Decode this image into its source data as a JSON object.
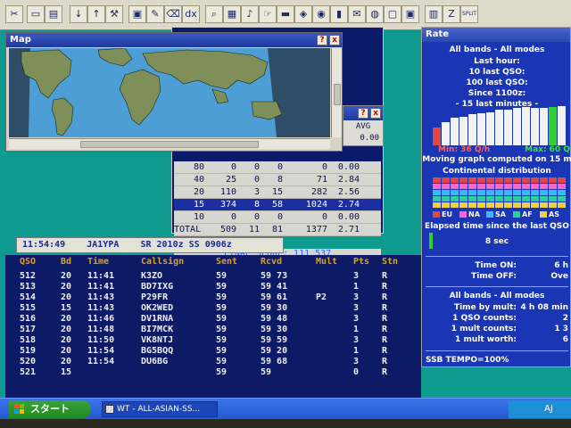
{
  "toolbar": {
    "icons": [
      "cut-icon",
      "open-folder-icon",
      "open-icon",
      "down-arrow-icon",
      "up-arrow-icon",
      "tools-icon",
      "print-icon",
      "edit-icon",
      "clear-icon",
      "dx-icon",
      "zoom-icon",
      "grid-icon",
      "bell-icon",
      "hand-icon",
      "monitor-icon",
      "tag-icon",
      "radio-icon",
      "chart-icon",
      "message-icon",
      "globe-icon",
      "window-icon",
      "window2-icon",
      "book-icon",
      "z-icon",
      "split-icon"
    ],
    "dx_label": "dx",
    "z_label": "Z",
    "split_label": "SPLIT"
  },
  "map": {
    "title": "Map",
    "help_label": "?",
    "close_label": "x"
  },
  "smallwin": {
    "help_label": "?",
    "close_label": "x"
  },
  "avgwin": {
    "help_label": "?",
    "close_label": "x",
    "header": "AVG",
    "first_value": "0.00"
  },
  "stats": {
    "rows": [
      {
        "band": "80",
        "qso": "0",
        "dupe": "0",
        "mult": "0",
        "pts": "0",
        "avg": "0.00",
        "hl": false
      },
      {
        "band": "40",
        "qso": "25",
        "dupe": "0",
        "mult": "8",
        "pts": "71",
        "avg": "2.84",
        "hl": false
      },
      {
        "band": "20",
        "qso": "110",
        "dupe": "3",
        "mult": "15",
        "pts": "282",
        "avg": "2.56",
        "hl": false
      },
      {
        "band": "15",
        "qso": "374",
        "dupe": "8",
        "mult": "58",
        "pts": "1024",
        "avg": "2.74",
        "hl": true
      },
      {
        "band": "10",
        "qso": "0",
        "dupe": "0",
        "mult": "0",
        "pts": "0",
        "avg": "0.00",
        "hl": false
      },
      {
        "band": "TOTAL",
        "qso": "509",
        "dupe": "11",
        "mult": "81",
        "pts": "1377",
        "avg": "2.71",
        "hl": false
      }
    ],
    "final_score": "FINAL SCORE: 111 537"
  },
  "rate": {
    "title": "Rate",
    "line1": "All bands - All modes",
    "line2": "Last hour:",
    "line3": "10 last QSO:",
    "line4": "100 last QSO:",
    "line5": "Since 1100z:",
    "line6": "- 15 last minutes -",
    "min_label": "Min: 36 Q/h",
    "max_label": "Max: 60 Q",
    "moving": "Moving graph computed on 15 m",
    "continental": "Continental distribution",
    "cont_labels": [
      "EU",
      "NA",
      "SA",
      "AF",
      "AS"
    ],
    "elapsed": "Elapsed time since the last QSO",
    "elapsed_val": "8 sec",
    "time_on_label": "Time ON:",
    "time_on_val": "6 h",
    "time_off_label": "Time OFF:",
    "time_off_val": "Ove",
    "all_bands2": "All bands - All modes",
    "by_mult_label": "Time by mult:",
    "by_mult_val": "4 h 08 min",
    "qso_counts_label": "1 QSO counts:",
    "qso_counts_val": "2",
    "mult_counts_label": "1 mult counts:",
    "mult_counts_val": "1 3",
    "mult_worth_label": "1 mult worth:",
    "mult_worth_val": "6",
    "footer": "SSB  TEMPO=100%",
    "rate_bar_values": [
      0.45,
      0.6,
      0.7,
      0.72,
      0.8,
      0.82,
      0.85,
      0.9,
      0.92,
      0.95,
      0.98,
      0.95,
      0.95,
      0.97,
      1.0
    ],
    "cont_colors": [
      "#e04848",
      "#ff66cc",
      "#39b8ff",
      "#2ad09a",
      "#f0d040"
    ]
  },
  "log": {
    "status": "11:54:49    JA1YPA    SR 2010z SS 0906z",
    "headers": [
      "QSO",
      "Bd",
      "Time",
      "Callsign",
      "Sent",
      "Rcvd",
      "Mult",
      "Pts",
      "Stn"
    ],
    "rows": [
      {
        "qso": "512",
        "bd": "20",
        "time": "11:41",
        "call": "K3ZO",
        "sent": "59",
        "rcvd": "59 73",
        "mult": "",
        "pts": "3",
        "stn": "R"
      },
      {
        "qso": "513",
        "bd": "20",
        "time": "11:41",
        "call": "BD7IXG",
        "sent": "59",
        "rcvd": "59 41",
        "mult": "",
        "pts": "1",
        "stn": "R"
      },
      {
        "qso": "514",
        "bd": "20",
        "time": "11:43",
        "call": "P29FR",
        "sent": "59",
        "rcvd": "59 61",
        "mult": "P2",
        "pts": "3",
        "stn": "R"
      },
      {
        "qso": "515",
        "bd": "15",
        "time": "11:43",
        "call": "OK2WED",
        "sent": "59",
        "rcvd": "59 30",
        "mult": "",
        "pts": "3",
        "stn": "R"
      },
      {
        "qso": "516",
        "bd": "20",
        "time": "11:46",
        "call": "DV1RNA",
        "sent": "59",
        "rcvd": "59 48",
        "mult": "",
        "pts": "3",
        "stn": "R"
      },
      {
        "qso": "517",
        "bd": "20",
        "time": "11:48",
        "call": "BI7MCK",
        "sent": "59",
        "rcvd": "59 30",
        "mult": "",
        "pts": "1",
        "stn": "R"
      },
      {
        "qso": "518",
        "bd": "20",
        "time": "11:50",
        "call": "VK8NTJ",
        "sent": "59",
        "rcvd": "59 59",
        "mult": "",
        "pts": "3",
        "stn": "R"
      },
      {
        "qso": "519",
        "bd": "20",
        "time": "11:54",
        "call": "BG5BQQ",
        "sent": "59",
        "rcvd": "59 20",
        "mult": "",
        "pts": "1",
        "stn": "R"
      },
      {
        "qso": "520",
        "bd": "20",
        "time": "11:54",
        "call": "DU6BG",
        "sent": "59",
        "rcvd": "59 68",
        "mult": "",
        "pts": "3",
        "stn": "R"
      },
      {
        "qso": "521",
        "bd": "15",
        "time": "",
        "call": "",
        "sent": "59",
        "rcvd": "59",
        "mult": "",
        "pts": "0",
        "stn": "R"
      }
    ]
  },
  "taskbar": {
    "start_label": "スタート",
    "task_label": "WT - ALL-ASIAN-SS...",
    "tray_text": "AJ"
  }
}
